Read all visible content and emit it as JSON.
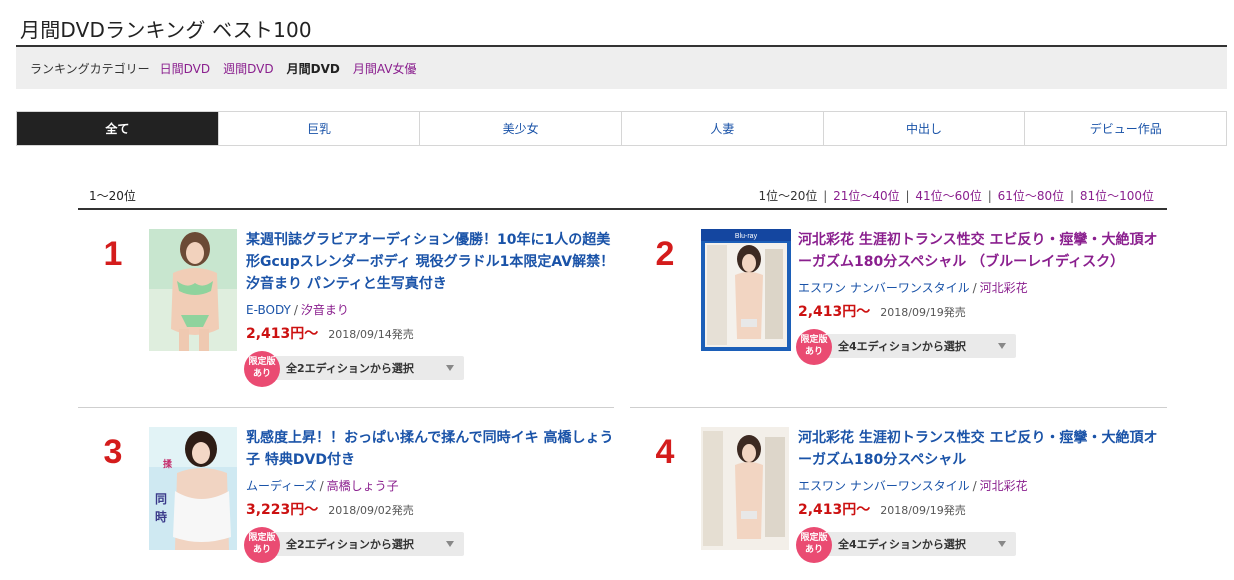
{
  "page": {
    "title": "月間DVDランキング ベスト100"
  },
  "category": {
    "label": "ランキングカテゴリー",
    "items": [
      {
        "label": "日間DVD",
        "current": false
      },
      {
        "label": "週間DVD",
        "current": false
      },
      {
        "label": "月間DVD",
        "current": true
      },
      {
        "label": "月間AV女優",
        "current": false
      }
    ]
  },
  "genres": [
    "全て",
    "巨乳",
    "美少女",
    "人妻",
    "中出し",
    "デビュー作品"
  ],
  "list": {
    "range": "1〜20位",
    "pager": [
      "1位〜20位",
      "21位〜40位",
      "41位〜60位",
      "61位〜80位",
      "81位〜100位"
    ],
    "pager_sep": "|"
  },
  "items": [
    {
      "rank": "1",
      "title": "某週刊誌グラビアオーディション優勝！10年に1人の超美形Gcupスレンダーボディ 現役グラドル1本限定AV解禁！ 汐音まり パンティと生写真付き",
      "maker": "E-BODY",
      "actress": "汐音まり",
      "price": "2,413円〜",
      "release": "2018/09/14発売",
      "badge": [
        "限定版",
        "あり"
      ],
      "edition": "全2エディションから選択",
      "visited": false,
      "cover": "photo-pink-bikini"
    },
    {
      "rank": "2",
      "title": "河北彩花 生涯初トランス性交 エビ反り・痙攣・大絶頂オーガズム180分スペシャル （ブルーレイディスク）",
      "maker": "エスワン ナンバーワンスタイル",
      "actress": "河北彩花",
      "price": "2,413円〜",
      "release": "2018/09/19発売",
      "badge": [
        "限定版",
        "あり"
      ],
      "edition": "全4エディションから選択",
      "visited": true,
      "cover": "bluray-case"
    },
    {
      "rank": "3",
      "title": "乳感度上昇！！おっぱい揉んで揉んで同時イキ 高橋しょう子 特典DVD付き",
      "maker": "ムーディーズ",
      "actress": "高橋しょう子",
      "price": "3,223円〜",
      "release": "2018/09/02発売",
      "badge": [
        "限定版",
        "あり"
      ],
      "edition": "全2エディションから選択",
      "visited": false,
      "cover": "photo-white-lingerie"
    },
    {
      "rank": "4",
      "title": "河北彩花 生涯初トランス性交 エビ反り・痙攣・大絶頂オーガズム180分スペシャル",
      "maker": "エスワン ナンバーワンスタイル",
      "actress": "河北彩花",
      "price": "2,413円〜",
      "release": "2018/09/19発売",
      "badge": [
        "限定版",
        "あり"
      ],
      "edition": "全4エディションから選択",
      "visited": false,
      "cover": "dvd-case"
    }
  ],
  "colors": {
    "rank": "#d41c1c",
    "link": "#1a53a8",
    "visited": "#8a1f8e",
    "price": "#cc1111",
    "badge": "#ea4b72"
  }
}
